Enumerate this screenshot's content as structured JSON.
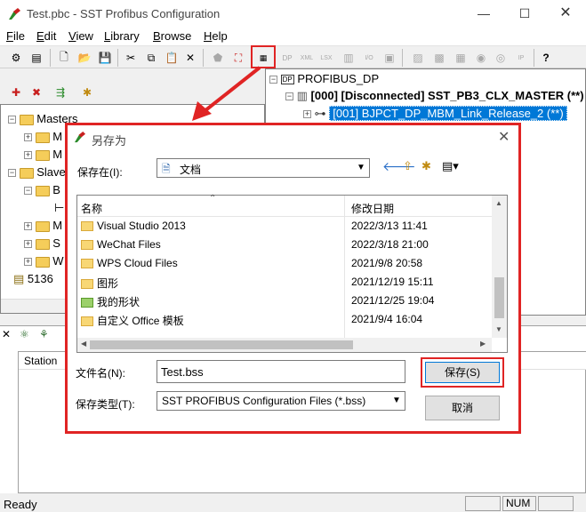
{
  "window": {
    "title": "Test.pbc - SST Profibus Configuration"
  },
  "menu": [
    "File",
    "Edit",
    "View",
    "Library",
    "Browse",
    "Help"
  ],
  "menu_underline": [
    "F",
    "E",
    "V",
    "L",
    "B",
    "H"
  ],
  "right_tree": {
    "root": "PROFIBUS_DP",
    "master": "[000]  [Disconnected]  SST_PB3_CLX_MASTER (**)",
    "slave": "[001] BJPCT_DP_MBM_Link_Release_2 (**)"
  },
  "left_tree": {
    "masters": "Masters",
    "m1": "M",
    "m2": "M",
    "slaves": "Slave",
    "s1": "B",
    "s2": "M",
    "s3": "S",
    "s4": "W",
    "bottom_item": "5136"
  },
  "bottom": {
    "col_station": "Station"
  },
  "status": {
    "text": "Ready",
    "num": "NUM"
  },
  "dialog": {
    "title": "另存为",
    "save_in_label": "保存在(I):",
    "save_in_value": "文档",
    "col_name": "名称",
    "col_date": "修改日期",
    "files": [
      {
        "name": "Visual Studio 2013",
        "date": "2022/3/13 11:41"
      },
      {
        "name": "WeChat Files",
        "date": "2022/3/18 21:00"
      },
      {
        "name": "WPS Cloud Files",
        "date": "2021/9/8 20:58"
      },
      {
        "name": "图形",
        "date": "2021/12/19 15:11"
      },
      {
        "name": "我的形状",
        "date": "2021/12/25 19:04"
      },
      {
        "name": "自定义 Office 模板",
        "date": "2021/9/4 16:04"
      }
    ],
    "filename_label": "文件名(N):",
    "filename_value": "Test.bss",
    "filetype_label": "保存类型(T):",
    "filetype_value": "SST PROFIBUS Configuration Files (*.bss)",
    "save_button": "保存(S)",
    "cancel_button": "取消"
  },
  "colors": {
    "highlight": "#e02424",
    "selection": "#0078d7"
  }
}
